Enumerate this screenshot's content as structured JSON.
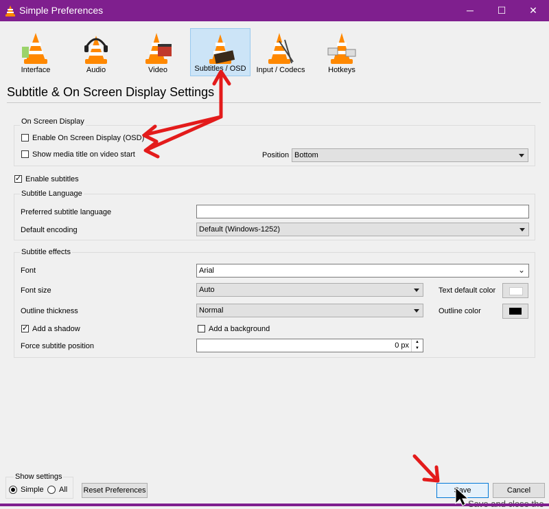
{
  "window": {
    "title": "Simple Preferences",
    "controls": [
      "minimize-icon",
      "maximize-icon",
      "close-icon"
    ],
    "accent": "#7f1f8e"
  },
  "categories": [
    {
      "label": "Interface",
      "icon": "interface-cone-icon",
      "selected": false
    },
    {
      "label": "Audio",
      "icon": "audio-headphones-cone-icon",
      "selected": false
    },
    {
      "label": "Video",
      "icon": "video-clapper-cone-icon",
      "selected": false
    },
    {
      "label": "Subtitles / OSD",
      "icon": "subtitles-cone-icon",
      "selected": true
    },
    {
      "label": "Input / Codecs",
      "icon": "input-codecs-cone-icon",
      "selected": false
    },
    {
      "label": "Hotkeys",
      "icon": "hotkeys-cone-icon",
      "selected": false
    }
  ],
  "heading": "Subtitle & On Screen Display Settings",
  "osd": {
    "title": "On Screen Display",
    "enable_osd_label": "Enable On Screen Display (OSD)",
    "enable_osd_checked": false,
    "show_title_label": "Show media title on video start",
    "show_title_checked": false,
    "position_label": "Position",
    "position_value": "Bottom"
  },
  "enable_subtitles": {
    "label": "Enable subtitles",
    "checked": true
  },
  "language": {
    "title": "Subtitle Language",
    "preferred_label": "Preferred subtitle language",
    "preferred_value": "",
    "encoding_label": "Default encoding",
    "encoding_value": "Default (Windows-1252)"
  },
  "effects": {
    "title": "Subtitle effects",
    "font_label": "Font",
    "font_value": "Arial",
    "font_size_label": "Font size",
    "font_size_value": "Auto",
    "text_color_label": "Text default color",
    "text_color": "#ffffff",
    "outline_label": "Outline thickness",
    "outline_value": "Normal",
    "outline_color_label": "Outline color",
    "outline_color": "#000000",
    "shadow_label": "Add a shadow",
    "shadow_checked": true,
    "background_label": "Add a background",
    "background_checked": false,
    "force_pos_label": "Force subtitle position",
    "force_pos_value": "0 px"
  },
  "footer": {
    "show_settings_label": "Show settings",
    "simple_label": "Simple",
    "simple_selected": true,
    "all_label": "All",
    "all_selected": false,
    "reset_label": "Reset Preferences",
    "save_label": "Save",
    "cancel_label": "Cancel",
    "tooltip_text": "Save and close the"
  },
  "annotation_color": "#e31b1b"
}
